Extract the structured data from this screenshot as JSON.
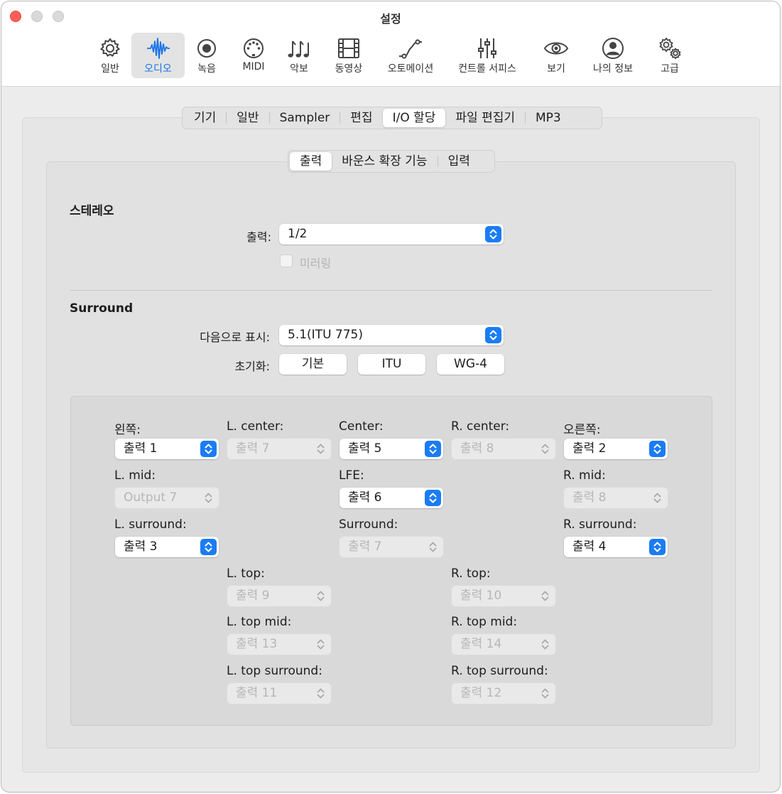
{
  "window": {
    "title": "설정"
  },
  "toolbar": {
    "items": [
      {
        "label": "일반",
        "icon": "gear-icon"
      },
      {
        "label": "오디오",
        "icon": "waveform-icon",
        "selected": true
      },
      {
        "label": "녹음",
        "icon": "record-icon"
      },
      {
        "label": "MIDI",
        "icon": "midi-connector-icon"
      },
      {
        "label": "악보",
        "icon": "music-notes-icon"
      },
      {
        "label": "동영상",
        "icon": "film-icon"
      },
      {
        "label": "오토메이션",
        "icon": "automation-curve-icon"
      },
      {
        "label": "컨트롤 서피스",
        "icon": "sliders-icon"
      },
      {
        "label": "보기",
        "icon": "eye-icon"
      },
      {
        "label": "나의 정보",
        "icon": "person-icon"
      },
      {
        "label": "고급",
        "icon": "gears-icon"
      }
    ]
  },
  "tabs": {
    "items": [
      "기기",
      "일반",
      "Sampler",
      "편집",
      "I/O 할당",
      "파일 편집기",
      "MP3"
    ],
    "active": 4
  },
  "subtabs": {
    "items": [
      "출력",
      "바운스 확장 기능",
      "입력"
    ],
    "active": 0
  },
  "stereo": {
    "title": "스테레오",
    "output_label": "출력:",
    "output_value": "1/2",
    "mirroring_label": "미러링"
  },
  "surround": {
    "title": "Surround",
    "display_label": "다음으로 표시:",
    "display_value": "5.1(ITU 775)",
    "init_label": "초기화:",
    "init_buttons": [
      "기본",
      "ITU",
      "WG-4"
    ]
  },
  "channels": {
    "left": {
      "label": "왼쪽:",
      "value": "출력 1"
    },
    "l_center": {
      "label": "L. center:",
      "value": "출력 7"
    },
    "center": {
      "label": "Center:",
      "value": "출력 5"
    },
    "r_center": {
      "label": "R. center:",
      "value": "출력 8"
    },
    "right": {
      "label": "오른쪽:",
      "value": "출력 2"
    },
    "l_mid": {
      "label": "L. mid:",
      "value": "Output 7"
    },
    "lfe": {
      "label": "LFE:",
      "value": "출력 6"
    },
    "r_mid": {
      "label": "R. mid:",
      "value": "출력 8"
    },
    "l_surround": {
      "label": "L. surround:",
      "value": "출력 3"
    },
    "surround": {
      "label": "Surround:",
      "value": "출력 7"
    },
    "r_surround": {
      "label": "R. surround:",
      "value": "출력 4"
    },
    "l_top": {
      "label": "L. top:",
      "value": "출력 9"
    },
    "r_top": {
      "label": "R. top:",
      "value": "출력 10"
    },
    "l_top_mid": {
      "label": "L. top mid:",
      "value": "출력 13"
    },
    "r_top_mid": {
      "label": "R. top mid:",
      "value": "출력 14"
    },
    "l_top_surround": {
      "label": "L. top surround:",
      "value": "출력 11"
    },
    "r_top_surround": {
      "label": "R. top surround:",
      "value": "출력 12"
    }
  },
  "colors": {
    "accent": "#1a7cf5",
    "close": "#fe5f57"
  }
}
